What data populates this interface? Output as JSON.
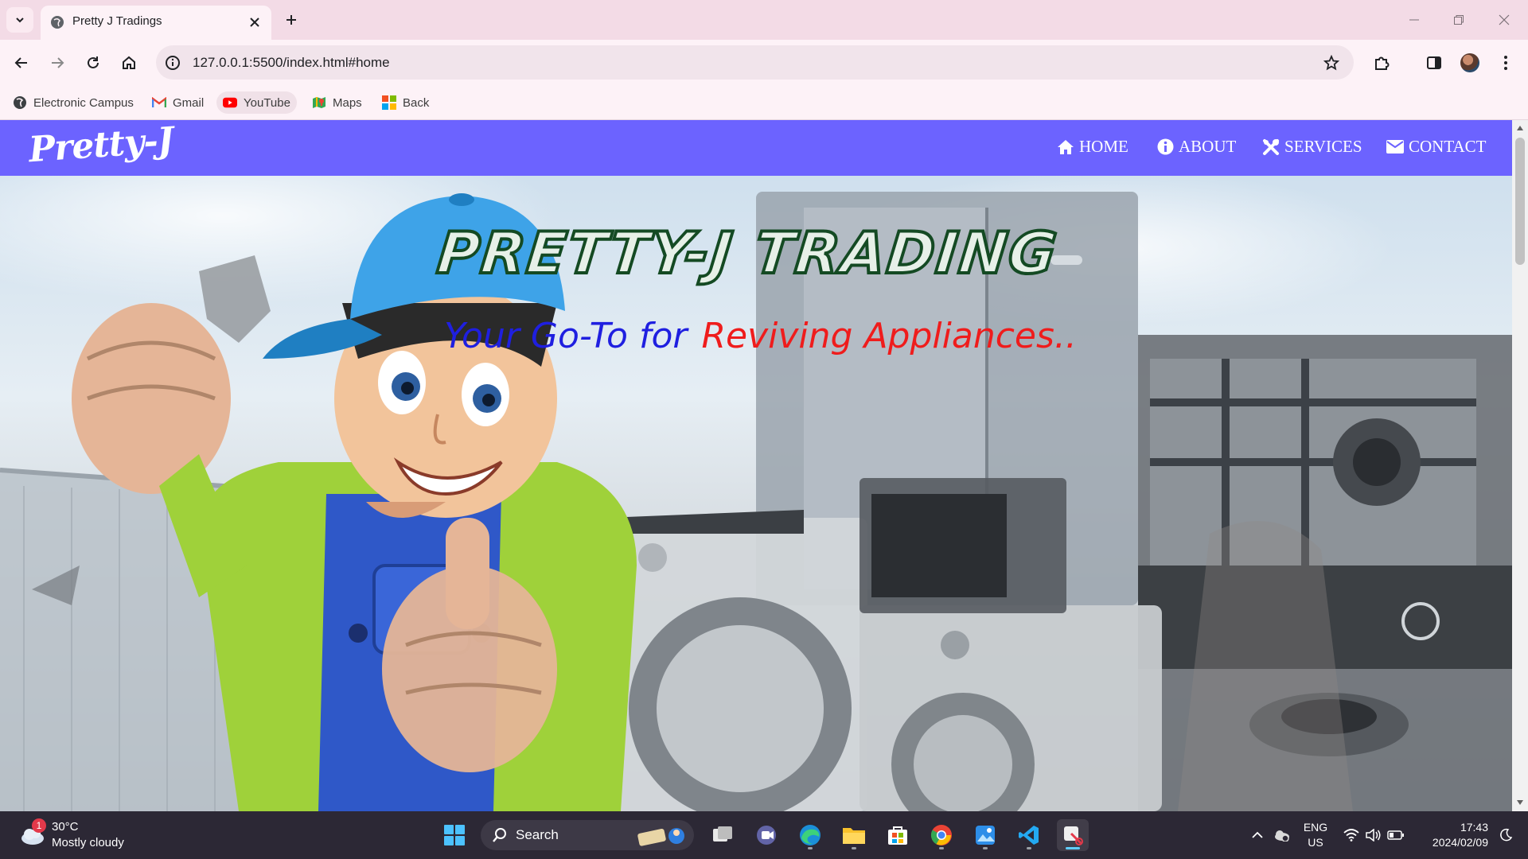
{
  "browser": {
    "tab_title": "Pretty J Tradings",
    "url": "127.0.0.1:5500/index.html#home",
    "bookmarks": [
      {
        "label": "Electronic Campus",
        "icon": "globe-icon"
      },
      {
        "label": "Gmail",
        "icon": "gmail-icon"
      },
      {
        "label": "YouTube",
        "icon": "youtube-icon"
      },
      {
        "label": "Maps",
        "icon": "maps-icon"
      },
      {
        "label": "Back",
        "icon": "windows-grid-icon"
      }
    ]
  },
  "site": {
    "logo": "Pretty-J",
    "nav": [
      {
        "label": "HOME",
        "icon": "home-icon"
      },
      {
        "label": "ABOUT",
        "icon": "info-icon"
      },
      {
        "label": "SERVICES",
        "icon": "tools-icon"
      },
      {
        "label": "CONTACT",
        "icon": "envelope-icon"
      }
    ],
    "hero": {
      "title": "PRETTY-J TRADING",
      "subtitle_part1": "Your Go-To for",
      "subtitle_part2": "Reviving Appliances.."
    },
    "colors": {
      "nav_bg": "#6c63ff",
      "subtitle_blue": "#1f1fe0",
      "subtitle_red": "#ef1c1c",
      "title_outline": "#144a23"
    }
  },
  "taskbar": {
    "weather": {
      "temp": "30°C",
      "desc": "Mostly cloudy",
      "badge": "1"
    },
    "search_placeholder": "Search",
    "apps": [
      "start-icon",
      "task-view-icon",
      "teams-icon",
      "edge-icon",
      "file-explorer-icon",
      "store-icon",
      "chrome-icon",
      "photos-icon",
      "vscode-icon",
      "snipping-tool-icon"
    ],
    "lang_line1": "ENG",
    "lang_line2": "US",
    "time": "17:43",
    "date": "2024/02/09"
  }
}
